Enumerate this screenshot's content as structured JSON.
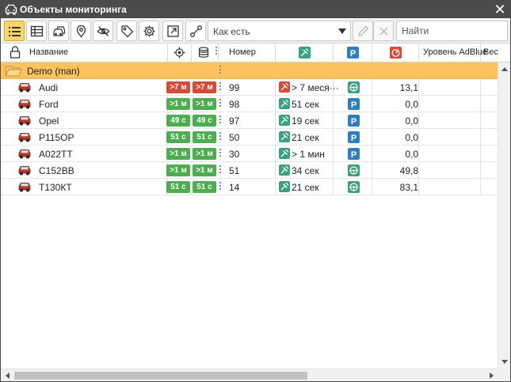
{
  "window": {
    "title": "Объекты мониторинга",
    "close": "✕"
  },
  "toolbar": {
    "buttons": [
      {
        "name": "list-view-icon",
        "active": true
      },
      {
        "name": "table-view-icon"
      },
      {
        "name": "vehicles-icon"
      },
      {
        "name": "geozone-icon"
      },
      {
        "name": "hidden-icon"
      },
      {
        "name": "tag-icon"
      },
      {
        "name": "gear-icon"
      },
      {
        "name": "export-icon"
      },
      {
        "name": "connect-icon"
      },
      {
        "name": "edit-icon",
        "disabled": true
      },
      {
        "name": "delete-icon",
        "disabled": true
      }
    ],
    "sort_select": "Как есть",
    "search_placeholder": "Найти"
  },
  "columns": {
    "name": "Название",
    "number": "Номер",
    "adblue": "Уровень AdBlue",
    "weight": "Вес"
  },
  "colors": {
    "group_bg": "#fbc25e",
    "red_badge": "#d84a36",
    "green_badge": "#4dae4f",
    "status_green": "#3aa27a",
    "parking_blue": "#2f7dc3",
    "alert_red": "#d84a36"
  },
  "group": {
    "name": "Demo (man)"
  },
  "rows": [
    {
      "name": "Audi",
      "b1": ">7 м",
      "b2": ">7 м",
      "b_color": "red",
      "number": "99",
      "time": "> 7 меся···",
      "time_state": "alert",
      "status": "moving",
      "fuel": "13,1"
    },
    {
      "name": "Ford",
      "b1": ">1 м",
      "b2": ">1 м",
      "b_color": "green",
      "number": "98",
      "time": "51 сек",
      "time_state": "ok",
      "status": "parking",
      "fuel": "0,0"
    },
    {
      "name": "Opel",
      "b1": "49 с",
      "b2": "49 с",
      "b_color": "green",
      "number": "97",
      "time": "19 сек",
      "time_state": "ok",
      "status": "parking",
      "fuel": "0,0"
    },
    {
      "name": "Р115ОР",
      "b1": "51 с",
      "b2": "51 с",
      "b_color": "green",
      "number": "50",
      "time": "21 сек",
      "time_state": "ok",
      "status": "parking",
      "fuel": "0,0"
    },
    {
      "name": "А022ТТ",
      "b1": ">1 м",
      "b2": ">1 м",
      "b_color": "green",
      "number": "30",
      "time": "> 1 мин",
      "time_state": "ok",
      "status": "parking",
      "fuel": "0,0"
    },
    {
      "name": "С152ВВ",
      "b1": ">1 м",
      "b2": ">1 м",
      "b_color": "green",
      "number": "51",
      "time": "34 сек",
      "time_state": "ok",
      "status": "moving",
      "fuel": "49,8"
    },
    {
      "name": "Т130КТ",
      "b1": "51 с",
      "b2": "51 с",
      "b_color": "green",
      "number": "14",
      "time": "21 сек",
      "time_state": "ok",
      "status": "moving",
      "fuel": "83,1"
    }
  ]
}
